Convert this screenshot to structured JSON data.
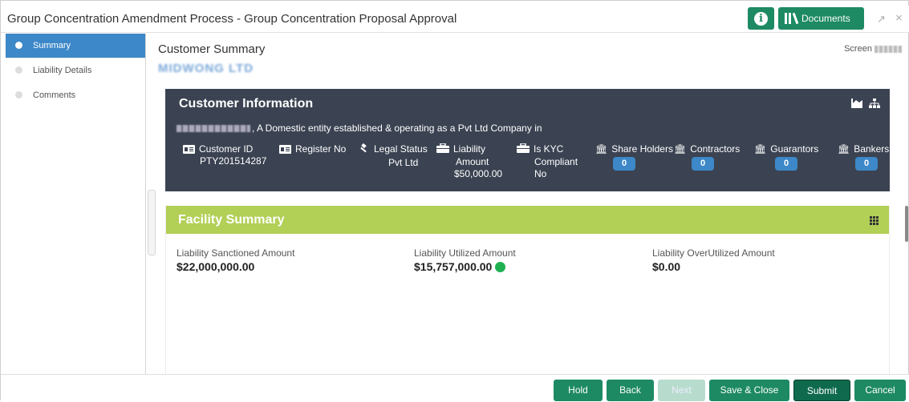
{
  "header": {
    "title": "Group Concentration Amendment Process - Group Concentration Proposal Approval",
    "info_icon": "i",
    "documents_label": "Documents",
    "minimize_icon": "↗",
    "close_icon": "×"
  },
  "sidebar": {
    "items": [
      {
        "label": "Summary",
        "active": true
      },
      {
        "label": "Liability Details",
        "active": false
      },
      {
        "label": "Comments",
        "active": false
      }
    ]
  },
  "main": {
    "title": "Customer Summary",
    "customer_name": "MIDWONG LTD",
    "screen_label": "Screen"
  },
  "customer_info": {
    "title": "Customer Information",
    "description": ", A Domestic entity established & operating as a Pvt Ltd Company in",
    "fields": {
      "customer_id": {
        "label": "Customer ID",
        "value": "PTY201514287"
      },
      "register_no": {
        "label": "Register No",
        "value": ""
      },
      "legal_status": {
        "label": "Legal Status",
        "value": "Pvt Ltd"
      },
      "liability_amount": {
        "label1": "Liability",
        "label2": "Amount",
        "value": "$50,000.00"
      },
      "kyc": {
        "label1": "Is KYC",
        "label2": "Compliant",
        "value": "No"
      },
      "share_holders": {
        "label": "Share Holders",
        "count": "0"
      },
      "contractors": {
        "label": "Contractors",
        "count": "0"
      },
      "guarantors": {
        "label": "Guarantors",
        "count": "0"
      },
      "bankers": {
        "label": "Bankers",
        "count": "0"
      }
    },
    "icons": [
      "chart-icon",
      "hierarchy-icon"
    ]
  },
  "facility": {
    "title": "Facility Summary",
    "items": [
      {
        "label": "Liability Sanctioned Amount",
        "amount": "$22,000,000.00"
      },
      {
        "label": "Liability Utilized Amount",
        "amount": "$15,757,000.00"
      },
      {
        "label": "Liability OverUtilized Amount",
        "amount": "$0.00"
      }
    ],
    "utilized_status_color": "#1fb151"
  },
  "footer": {
    "buttons": [
      "Hold",
      "Back",
      "Next",
      "Save & Close",
      "Submit",
      "Cancel"
    ]
  },
  "colors": {
    "accent": "#1e8a64",
    "sidebar_active": "#3d88c8",
    "customer_card": "#3b4352",
    "facility_header": "#b2cf56"
  }
}
